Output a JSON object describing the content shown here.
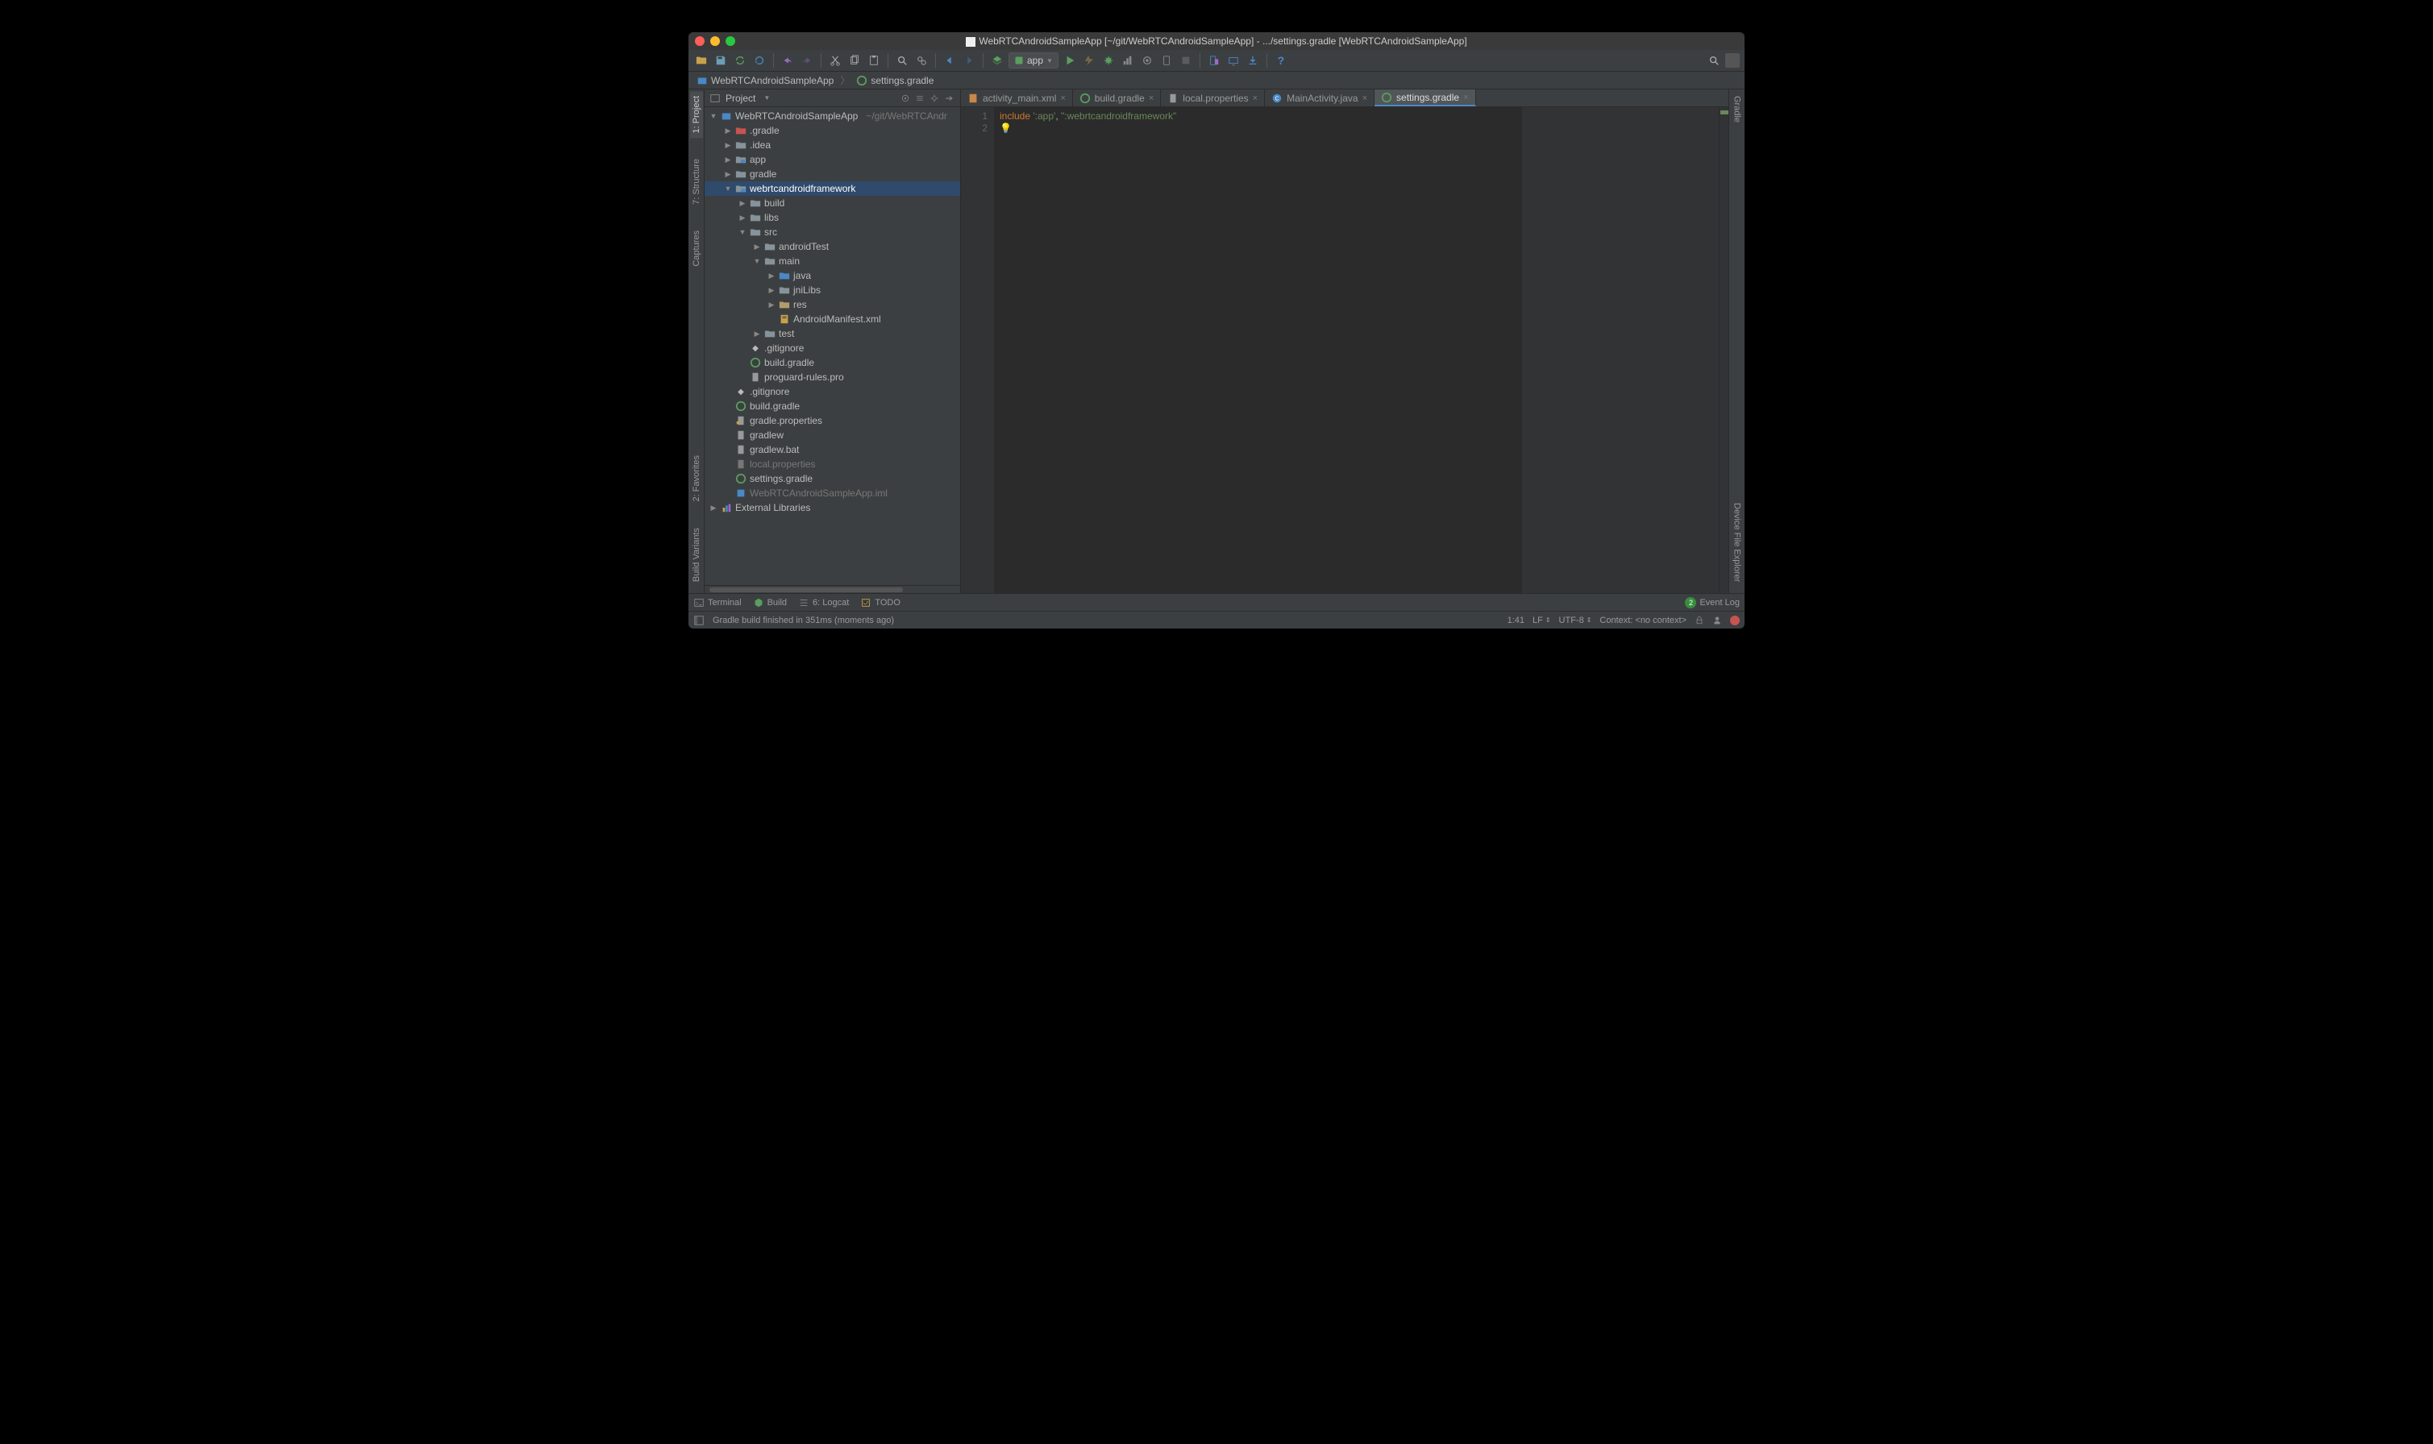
{
  "window_title": "WebRTCAndroidSampleApp [~/git/WebRTCAndroidSampleApp] - .../settings.gradle [WebRTCAndroidSampleApp]",
  "breadcrumb": {
    "root": "WebRTCAndroidSampleApp",
    "file": "settings.gradle"
  },
  "run_config": "app",
  "panel": {
    "title": "Project"
  },
  "tree": {
    "root": "WebRTCAndroidSampleApp",
    "root_hint": "~/git/WebRTCAndr",
    "gradle_dir": ".gradle",
    "idea_dir": ".idea",
    "app_dir": "app",
    "gradle_folder": "gradle",
    "framework": "webrtcandroidframework",
    "build": "build",
    "libs": "libs",
    "src": "src",
    "androidTest": "androidTest",
    "main": "main",
    "java": "java",
    "jniLibs": "jniLibs",
    "res": "res",
    "manifest": "AndroidManifest.xml",
    "test": "test",
    "gitignore": ".gitignore",
    "build_gradle": "build.gradle",
    "proguard": "proguard-rules.pro",
    "gitignore2": ".gitignore",
    "build_gradle2": "build.gradle",
    "gradle_props": "gradle.properties",
    "gradlew": "gradlew",
    "gradlew_bat": "gradlew.bat",
    "local_props": "local.properties",
    "settings_gradle": "settings.gradle",
    "iml": "WebRTCAndroidSampleApp.iml",
    "ext_lib": "External Libraries"
  },
  "tabs": [
    {
      "label": "activity_main.xml"
    },
    {
      "label": "build.gradle"
    },
    {
      "label": "local.properties"
    },
    {
      "label": "MainActivity.java"
    },
    {
      "label": "settings.gradle"
    }
  ],
  "editor": {
    "line1_kw": "include",
    "line1_str1": "':app'",
    "line1_sep": ", ",
    "line1_str2": "\":webrtcandroidframework\"",
    "lineno1": "1",
    "lineno2": "2"
  },
  "bottom": {
    "terminal": "Terminal",
    "build": "Build",
    "logcat": "6: Logcat",
    "todo": "TODO",
    "event_log": "Event Log",
    "event_badge": "2"
  },
  "status": {
    "msg": "Gradle build finished in 351ms (moments ago)",
    "pos": "1:41",
    "line_sep": "LF",
    "encoding": "UTF-8",
    "context_label": "Context:",
    "context_value": "<no context>"
  },
  "rails": {
    "project": "1: Project",
    "structure": "7: Structure",
    "captures": "Captures",
    "favorites": "2: Favorites",
    "build_variants": "Build Variants",
    "gradle": "Gradle",
    "device_explorer": "Device File Explorer"
  }
}
